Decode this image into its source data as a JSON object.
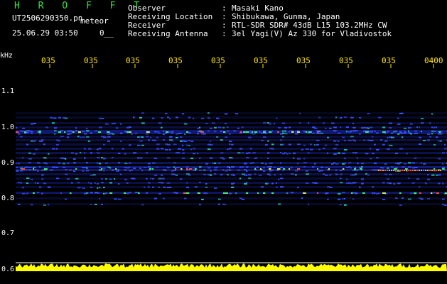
{
  "header": {
    "brand": "H R O F F T",
    "filename": "UT2506290350.pn",
    "tag": "meteor",
    "datetime": "25.06.29 03:50",
    "count": "0__"
  },
  "info": [
    {
      "label": "Observer",
      "value": "Masaki Kano"
    },
    {
      "label": "Receiving Location",
      "value": "Shibukawa, Gunma, Japan"
    },
    {
      "label": "Receiver",
      "value": "RTL-SDR SDR# 43dB L15 103.2MHz CW"
    },
    {
      "label": "Receiving Antenna",
      "value": "3el Yagi(V) Az 330 for Vladivostok"
    }
  ],
  "axis": {
    "unit": "kHz",
    "y_ticks": [
      "1.1",
      "1.0",
      "0.9",
      "0.8",
      "0.7",
      "0.6"
    ],
    "x_ticks": [
      "035",
      "035",
      "035",
      "035",
      "035",
      "035",
      "035",
      "035",
      "035",
      "0400"
    ]
  },
  "colors": {
    "background": "#000000",
    "brand_green": "#2ee83a",
    "time_yellow": "#ffe600",
    "signal_noise": "#ffff00",
    "spectrum_blue": "#1e2fd0"
  }
}
